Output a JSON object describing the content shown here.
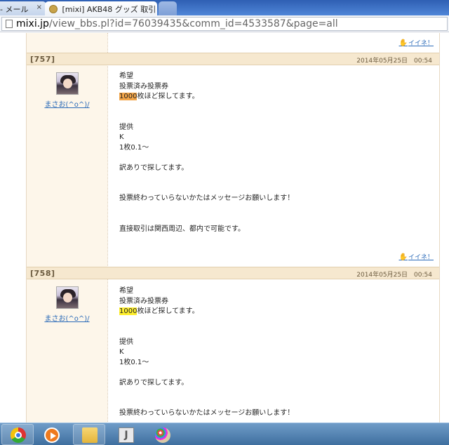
{
  "browser": {
    "tabs": [
      {
        "title": "- メール",
        "close": "×"
      },
      {
        "title": "[mixi] AKB48 グッズ 取引"
      },
      {
        "title": ""
      }
    ],
    "url": {
      "host": "mixi.jp",
      "rest": "/view_bbs.pl?id=76039435&comm_id=4533587&page=all"
    }
  },
  "page": {
    "top_like": "イイネ！",
    "posts": [
      {
        "number": "[757]",
        "date": "2014年05月25日　00:54",
        "author": "まさお(^o^)/",
        "like": "イイネ！",
        "lines": [
          "希望",
          "投票済み投票券",
          {
            "hl": "1000",
            "rest": "枚ほど探してます。"
          },
          "",
          "",
          "提供",
          "K",
          "1枚0.1〜",
          "",
          "訳ありで探してます。",
          "",
          "",
          "投票終わっていらないかたはメッセージお願いします！",
          "",
          "",
          "直接取引は関西周辺、都内で可能です。"
        ],
        "highlight_color": "#f3a64a"
      },
      {
        "number": "[758]",
        "date": "2014年05月25日　00:54",
        "author": "まさお(^o^)/",
        "lines": [
          "希望",
          "投票済み投票券",
          {
            "hl": "1000",
            "rest": "枚ほど探してます。"
          },
          "",
          "",
          "提供",
          "K",
          "1枚0.1〜",
          "",
          "訳ありで探してます。",
          "",
          "",
          "投票終わっていらないかたはメッセージお願いします！"
        ],
        "highlight_color": "#ffef2f"
      }
    ]
  },
  "taskbar": {
    "items": [
      "chrome-icon",
      "media-player-icon",
      "file-explorer-icon",
      "j-app-icon",
      "paint-icon"
    ]
  }
}
